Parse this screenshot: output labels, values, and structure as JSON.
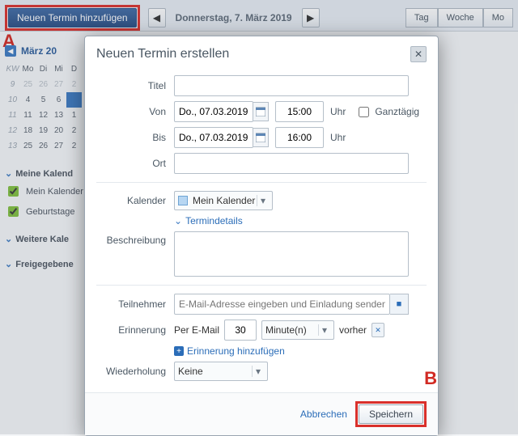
{
  "nav": {
    "new_event": "Neuen Termin hinzufügen",
    "date_heading": "Donnerstag, 7. März 2019",
    "views": {
      "day": "Tag",
      "week": "Woche",
      "month": "Mo"
    }
  },
  "markers": {
    "a": "A",
    "b": "B"
  },
  "minical": {
    "title": "März 20",
    "kw_label": "KW",
    "dow": [
      "Mo",
      "Di",
      "Mi",
      "D"
    ],
    "weeks": [
      {
        "kw": "9",
        "cells": [
          {
            "v": "25",
            "out": true
          },
          {
            "v": "26",
            "out": true
          },
          {
            "v": "27",
            "out": true
          },
          {
            "v": "2",
            "out": true
          }
        ]
      },
      {
        "kw": "10",
        "cells": [
          {
            "v": "4"
          },
          {
            "v": "5"
          },
          {
            "v": "6"
          },
          {
            "v": "",
            "today": true
          }
        ]
      },
      {
        "kw": "11",
        "cells": [
          {
            "v": "11"
          },
          {
            "v": "12"
          },
          {
            "v": "13"
          },
          {
            "v": "1"
          }
        ]
      },
      {
        "kw": "12",
        "cells": [
          {
            "v": "18"
          },
          {
            "v": "19"
          },
          {
            "v": "20"
          },
          {
            "v": "2"
          }
        ]
      },
      {
        "kw": "13",
        "cells": [
          {
            "v": "25"
          },
          {
            "v": "26"
          },
          {
            "v": "27"
          },
          {
            "v": "2"
          }
        ]
      }
    ]
  },
  "sidebar": {
    "my_title": "Meine Kalend",
    "items": [
      {
        "label": "Mein Kalender"
      },
      {
        "label": "Geburtstage"
      }
    ],
    "more_title": "Weitere Kale",
    "shared_title": "Freigegebene"
  },
  "dialog": {
    "title": "Neuen Termin erstellen",
    "labels": {
      "titel": "Titel",
      "von": "Von",
      "bis": "Bis",
      "ort": "Ort",
      "kalender": "Kalender",
      "details_link": "Termindetails",
      "beschreibung": "Beschreibung",
      "teilnehmer": "Teilnehmer",
      "teil_placeholder": "E-Mail-Adresse eingeben und Einladung senden",
      "erinnerung": "Erinnerung",
      "per_email": "Per E-Mail",
      "vorher": "vorher",
      "add_reminder": "Erinnerung hinzufügen",
      "wiederholung": "Wiederholung",
      "uhr": "Uhr",
      "ganztag": "Ganztägig"
    },
    "values": {
      "date_from": "Do., 07.03.2019",
      "time_from": "15:00",
      "date_to": "Do., 07.03.2019",
      "time_to": "16:00",
      "cal_selected": "Mein Kalender",
      "reminder_num": "30",
      "reminder_unit": "Minute(n)",
      "repeat": "Keine"
    },
    "footer": {
      "cancel": "Abbrechen",
      "save": "Speichern"
    }
  }
}
